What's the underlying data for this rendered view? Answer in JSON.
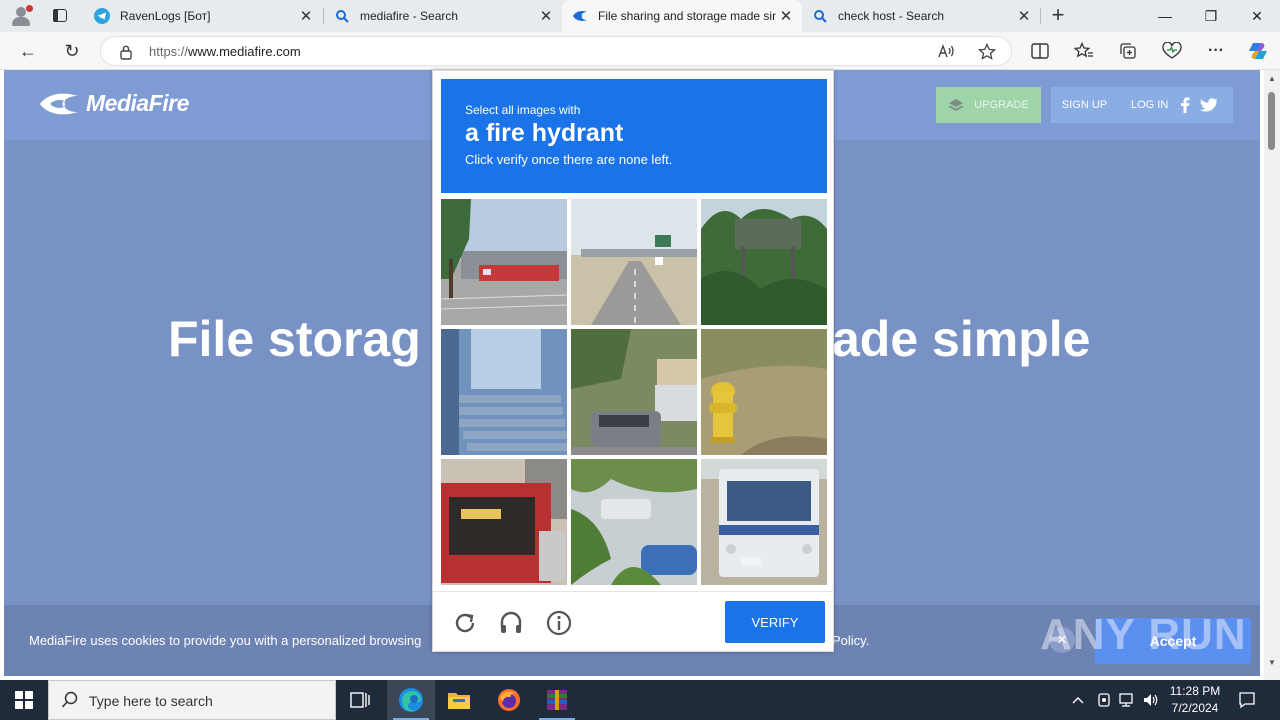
{
  "browser": {
    "tabs": [
      {
        "title": "RavenLogs [Бот]",
        "icon": "telegram-icon",
        "active": false
      },
      {
        "title": "mediafire - Search",
        "icon": "search-icon",
        "active": false
      },
      {
        "title": "File sharing and storage made sim",
        "icon": "mediafire-icon",
        "active": true
      },
      {
        "title": "check host - Search",
        "icon": "search-icon",
        "active": false
      }
    ],
    "new_tab": "+",
    "window_controls": {
      "minimize": "—",
      "restore": "❐",
      "close": "✕"
    },
    "url_prefix": "https://",
    "url_host": "www.mediafire.com",
    "nav": {
      "back": "←",
      "refresh": "↻"
    }
  },
  "site": {
    "logo_text": "MediaFire",
    "header": {
      "upgrade": "UPGRADE",
      "signup": "SIGN UP",
      "login": "LOG IN"
    },
    "hero_left": "File storag",
    "hero_right": "ade simple",
    "cookie": {
      "message": "MediaFire uses cookies to provide you with a personalized browsing",
      "policy_tail": "Policy.",
      "accept": "Accept"
    },
    "watermark": "ANY RUN"
  },
  "captcha": {
    "prompt_line1": "Select all images with",
    "prompt_target": "a fire hydrant",
    "prompt_line3": "Click verify once there are none left.",
    "tiles": [
      "trucks-depot",
      "highway-overpass",
      "road-sign-trees",
      "building-stairs",
      "parked-cars",
      "yellow-fire-hydrant",
      "red-bus",
      "car-behind-plants",
      "white-bus"
    ],
    "verify": "VERIFY",
    "footer_icons": [
      "refresh-icon",
      "headphones-icon",
      "info-icon"
    ]
  },
  "taskbar": {
    "search_placeholder": "Type here to search",
    "time": "11:28 PM",
    "date": "7/2/2024"
  }
}
